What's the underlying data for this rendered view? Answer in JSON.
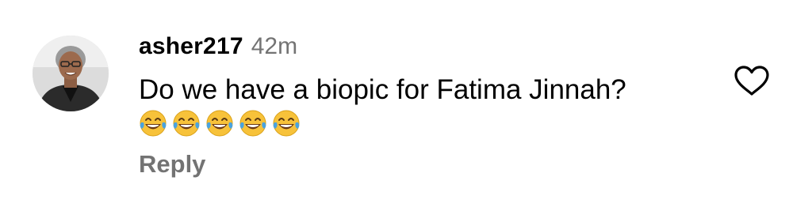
{
  "comment": {
    "username": "asher217",
    "timestamp": "42m",
    "text": "Do we have a biopic for Fatima Jinnah?",
    "emojis": [
      "😂",
      "😂",
      "😂",
      "😂",
      "😂"
    ],
    "reply_label": "Reply",
    "avatar_icon": "user-avatar",
    "like_icon": "heart-outline-icon"
  },
  "colors": {
    "primary_text": "#000000",
    "secondary_text": "#737373",
    "background": "#ffffff",
    "emoji_face": "#f7c23a",
    "tear": "#4aa3df"
  }
}
